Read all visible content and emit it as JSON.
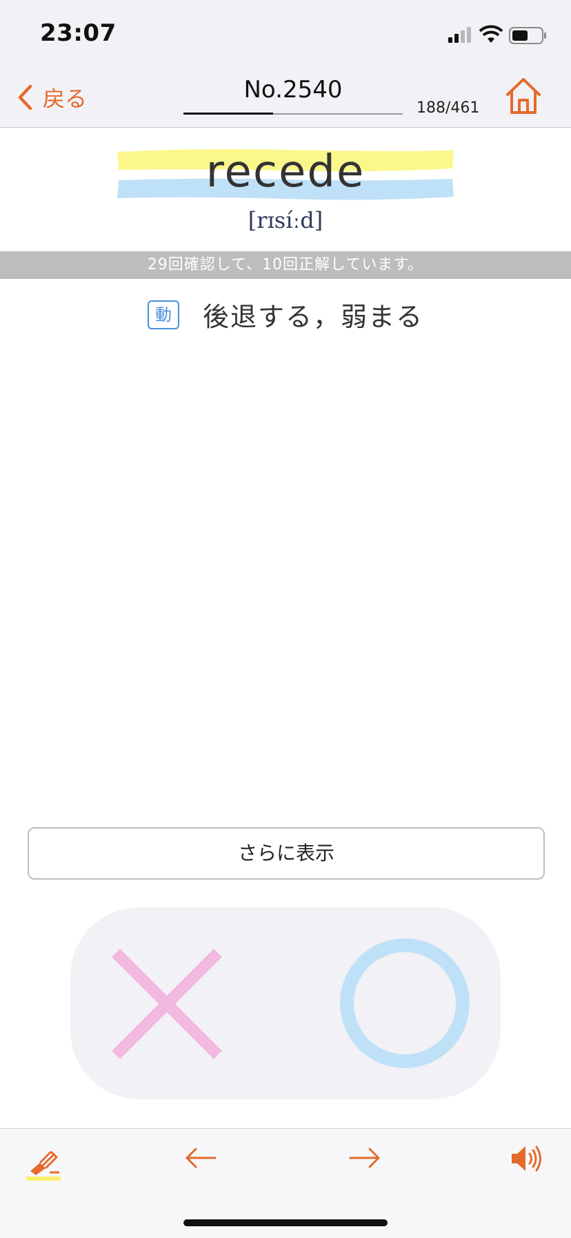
{
  "status_bar": {
    "time": "23:07"
  },
  "nav": {
    "back_label": "戻る",
    "title": "No.2540",
    "counter": "188/461",
    "progress_fraction": 0.41
  },
  "word": {
    "headword": "recede",
    "pronunciation": "[rɪsíːd]"
  },
  "stats_text": "29回確認して、10回正解しています。",
  "meaning": {
    "pos_label": "動",
    "text": "後退する，弱まる"
  },
  "more_button_label": "さらに表示",
  "colors": {
    "accent": "#e56a2c",
    "highlight_yellow": "#fbf78a",
    "highlight_blue": "#bfe1f7",
    "wrong_mark": "#f2b9e0",
    "right_mark": "#bfe1f7"
  },
  "icons": {
    "back": "chevron-left-icon",
    "home": "home-icon",
    "marker": "marker-pen-icon",
    "prev": "arrow-left-icon",
    "next": "arrow-right-icon",
    "sound": "speaker-icon",
    "wrong": "cross-mark-icon",
    "right": "circle-mark-icon"
  }
}
